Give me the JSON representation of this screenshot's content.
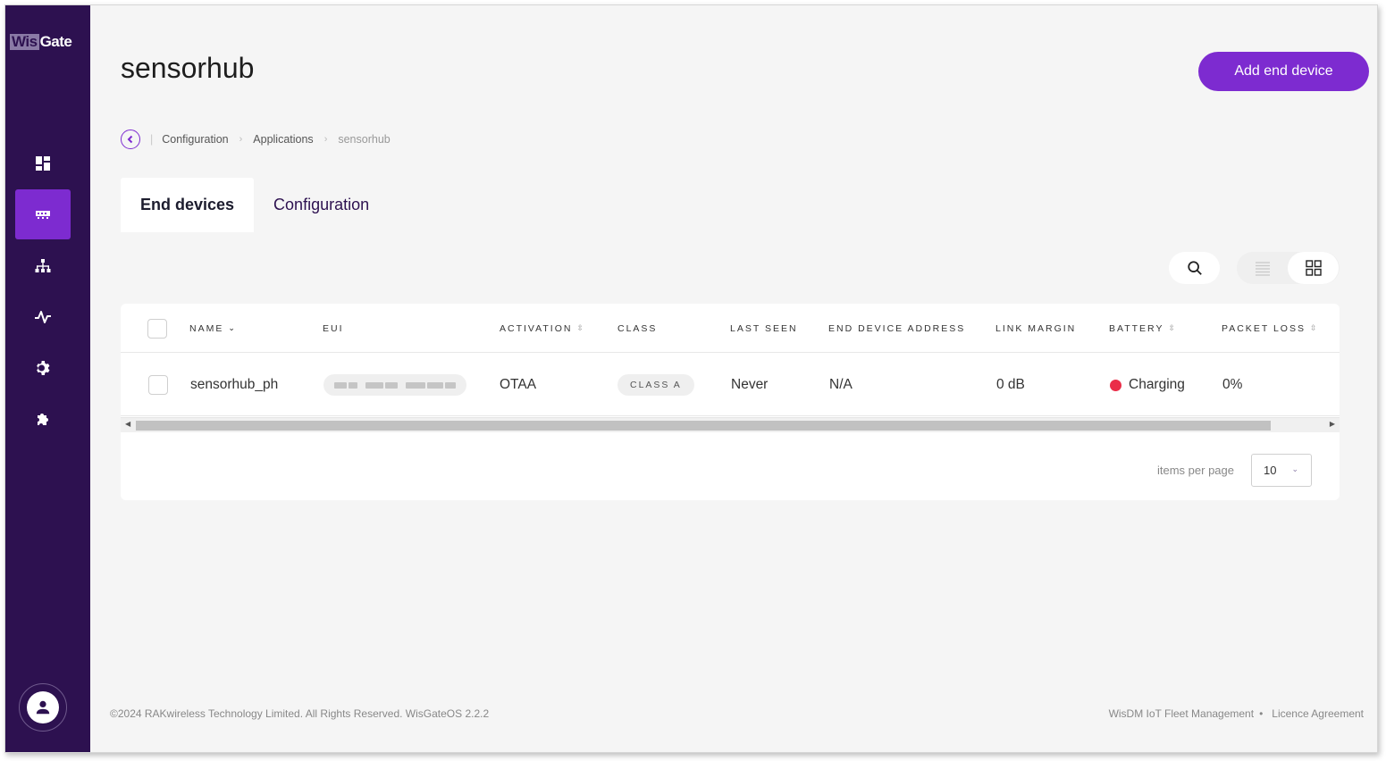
{
  "brand": {
    "logo_part1": "Wis",
    "logo_part2": "Gate"
  },
  "sidebar": {
    "items": [
      {
        "icon": "dashboard-icon",
        "active": false
      },
      {
        "icon": "gateway-icon",
        "active": true
      },
      {
        "icon": "network-icon",
        "active": false
      },
      {
        "icon": "activity-icon",
        "active": false
      },
      {
        "icon": "gear-icon",
        "active": false
      },
      {
        "icon": "puzzle-icon",
        "active": false
      }
    ],
    "user_icon": "user-icon"
  },
  "header": {
    "title": "sensorhub",
    "add_button_label": "Add end device"
  },
  "breadcrumb": {
    "items": [
      "Configuration",
      "Applications"
    ],
    "current": "sensorhub"
  },
  "tabs": [
    {
      "label": "End devices",
      "active": true
    },
    {
      "label": "Configuration",
      "active": false
    }
  ],
  "toolbar": {
    "view_mode": "grid"
  },
  "table": {
    "columns": [
      "Name",
      "EUI",
      "Activation",
      "Class",
      "Last seen",
      "End device address",
      "Link margin",
      "Battery",
      "Packet loss"
    ],
    "rows": [
      {
        "name": "sensorhub_ph",
        "eui": "",
        "activation": "OTAA",
        "class": "CLASS A",
        "last_seen": "Never",
        "address": "N/A",
        "link_margin": "0 dB",
        "battery": "Charging",
        "packet_loss": "0%"
      }
    ]
  },
  "pagination": {
    "label": "items per page",
    "value": "10"
  },
  "footer": {
    "copyright": "©2024 RAKwireless Technology Limited. All Rights Reserved. WisGateOS 2.2.2",
    "link1": "WisDM IoT Fleet Management",
    "link2": "Licence Agreement"
  },
  "colors": {
    "sidebar_bg": "#2d1150",
    "accent": "#7d2bd0",
    "battery_status": "#ea2d48"
  }
}
